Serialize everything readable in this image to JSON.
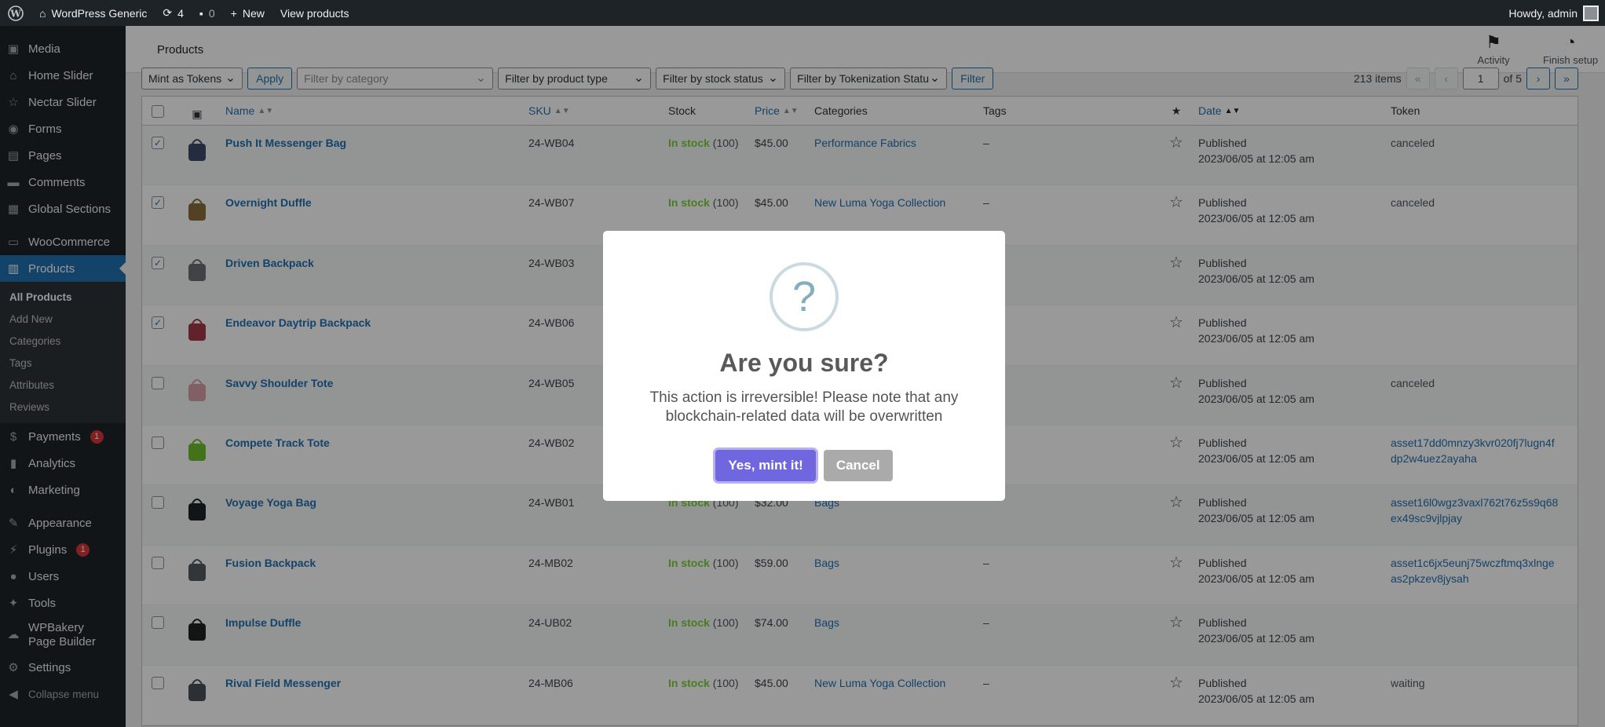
{
  "adminbar": {
    "site_name": "WordPress Generic",
    "updates_count": "4",
    "comments_count": "0",
    "new_label": "New",
    "view_products_label": "View products",
    "howdy": "Howdy, admin"
  },
  "sidebar": {
    "items_top": [
      {
        "label": "Media",
        "icon": "media-icon"
      },
      {
        "label": "Home Slider",
        "icon": "home-icon"
      },
      {
        "label": "Nectar Slider",
        "icon": "star-icon"
      },
      {
        "label": "Forms",
        "icon": "forms-icon"
      },
      {
        "label": "Pages",
        "icon": "pages-icon"
      },
      {
        "label": "Comments",
        "icon": "comments-icon"
      },
      {
        "label": "Global Sections",
        "icon": "sections-icon"
      },
      {
        "label": "WooCommerce",
        "icon": "woo-icon"
      },
      {
        "label": "Products",
        "icon": "products-icon"
      }
    ],
    "submenu": [
      "All Products",
      "Add New",
      "Categories",
      "Tags",
      "Attributes",
      "Reviews"
    ],
    "items_bottom": [
      {
        "label": "Payments",
        "badge": "1"
      },
      {
        "label": "Analytics"
      },
      {
        "label": "Marketing"
      },
      {
        "label": "Appearance"
      },
      {
        "label": "Plugins",
        "badge": "1"
      },
      {
        "label": "Users"
      },
      {
        "label": "Tools"
      },
      {
        "label": "WPBakery Page Builder"
      },
      {
        "label": "Settings"
      }
    ],
    "collapse": "Collapse menu"
  },
  "header": {
    "title": "Products",
    "activity": "Activity",
    "finish_setup": "Finish setup"
  },
  "toolbar": {
    "bulk_action": "Mint as Tokens",
    "apply": "Apply",
    "filter_category": "Filter by category",
    "filter_type": "Filter by product type",
    "filter_stock": "Filter by stock status",
    "filter_token": "Filter by Tokenization Statu",
    "filter_button": "Filter",
    "items_count": "213 items",
    "first": "«",
    "prev": "‹",
    "current_page": "1",
    "of_pages": "of 5",
    "next": "›",
    "last": "»"
  },
  "table": {
    "headers": {
      "name": "Name",
      "sku": "SKU",
      "stock": "Stock",
      "price": "Price",
      "categories": "Categories",
      "tags": "Tags",
      "date": "Date",
      "token": "Token"
    },
    "rows": [
      {
        "checked": true,
        "name": "Push It Messenger Bag",
        "sku": "24-WB04",
        "stock": "In stock",
        "qty": "(100)",
        "price": "$45.00",
        "category": "Performance Fabrics",
        "tags": "–",
        "status": "Published",
        "date": "2023/06/05 at 12:05 am",
        "token": "canceled",
        "token_link": false,
        "thumb_color": "#3d4a66"
      },
      {
        "checked": true,
        "name": "Overnight Duffle",
        "sku": "24-WB07",
        "stock": "In stock",
        "qty": "(100)",
        "price": "$45.00",
        "category": "New Luma Yoga Collection",
        "tags": "–",
        "status": "Published",
        "date": "2023/06/05 at 12:05 am",
        "token": "canceled",
        "token_link": false,
        "thumb_color": "#8a6d3b"
      },
      {
        "checked": true,
        "name": "Driven Backpack",
        "sku": "24-WB03",
        "stock": "",
        "qty": "",
        "price": "",
        "category": "",
        "tags": "",
        "status": "Published",
        "date": "2023/06/05 at 12:05 am",
        "token": "",
        "token_link": false,
        "thumb_color": "#6b6e73"
      },
      {
        "checked": true,
        "name": "Endeavor Daytrip Backpack",
        "sku": "24-WB06",
        "stock": "",
        "qty": "",
        "price": "",
        "category": "",
        "tags": "",
        "status": "Published",
        "date": "2023/06/05 at 12:05 am",
        "token": "",
        "token_link": false,
        "thumb_color": "#a33a4a"
      },
      {
        "checked": false,
        "name": "Savvy Shoulder Tote",
        "sku": "24-WB05",
        "stock": "",
        "qty": "",
        "price": "",
        "category": "",
        "tags": "",
        "status": "Published",
        "date": "2023/06/05 at 12:05 am",
        "token": "canceled",
        "token_link": false,
        "thumb_color": "#d7a1a8"
      },
      {
        "checked": false,
        "name": "Compete Track Tote",
        "sku": "24-WB02",
        "stock": "",
        "qty": "",
        "price": "",
        "category": "",
        "tags": "",
        "status": "Published",
        "date": "2023/06/05 at 12:05 am",
        "token": "asset17dd0mnzy3kvr020fj7lugn4fdp2w4uez2ayaha",
        "token_link": true,
        "thumb_color": "#6fbf2a"
      },
      {
        "checked": false,
        "name": "Voyage Yoga Bag",
        "sku": "24-WB01",
        "stock": "In stock",
        "qty": "(100)",
        "price": "$32.00",
        "category": "Bags",
        "tags": "",
        "status": "Published",
        "date": "2023/06/05 at 12:05 am",
        "token": "asset16l0wgz3vaxl762t76z5s9q68ex49sc9vjlpjay",
        "token_link": true,
        "thumb_color": "#1d2327"
      },
      {
        "checked": false,
        "name": "Fusion Backpack",
        "sku": "24-MB02",
        "stock": "In stock",
        "qty": "(100)",
        "price": "$59.00",
        "category": "Bags",
        "tags": "–",
        "status": "Published",
        "date": "2023/06/05 at 12:05 am",
        "token": "asset1c6jx5eunj75wczftmq3xlngeas2pkzev8jysah",
        "token_link": true,
        "thumb_color": "#555a60"
      },
      {
        "checked": false,
        "name": "Impulse Duffle",
        "sku": "24-UB02",
        "stock": "In stock",
        "qty": "(100)",
        "price": "$74.00",
        "category": "Bags",
        "tags": "–",
        "status": "Published",
        "date": "2023/06/05 at 12:05 am",
        "token": "",
        "token_link": false,
        "thumb_color": "#222"
      },
      {
        "checked": false,
        "name": "Rival Field Messenger",
        "sku": "24-MB06",
        "stock": "In stock",
        "qty": "(100)",
        "price": "$45.00",
        "category": "New Luma Yoga Collection",
        "tags": "–",
        "status": "Published",
        "date": "2023/06/05 at 12:05 am",
        "token": "waiting",
        "token_link": false,
        "thumb_color": "#4a4f55"
      }
    ]
  },
  "modal": {
    "icon": "?",
    "title": "Are you sure?",
    "text": "This action is irreversible! Please note that any blockchain-related data will be overwritten",
    "confirm": "Yes, mint it!",
    "cancel": "Cancel"
  }
}
